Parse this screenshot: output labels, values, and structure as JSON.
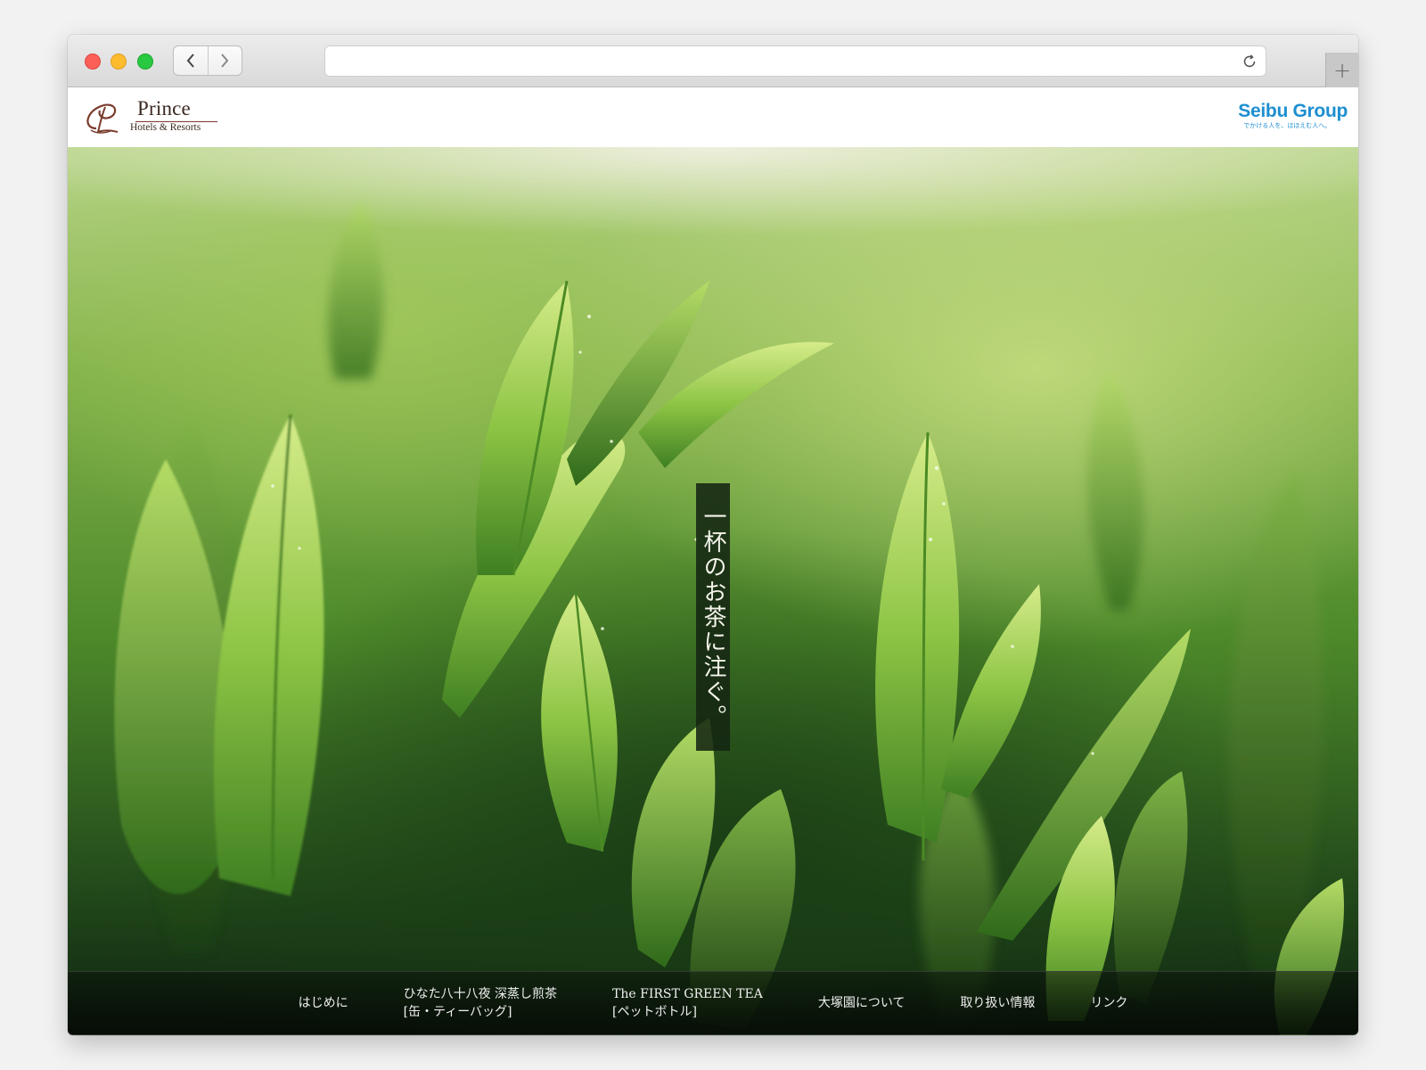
{
  "browser": {
    "url": "",
    "back_icon": "chevron-left-icon",
    "forward_icon": "chevron-right-icon",
    "reload_icon": "reload-icon",
    "new_tab_label": "+"
  },
  "header": {
    "prince_logo": {
      "name": "Prince",
      "subtitle": "Hotels & Resorts",
      "color": "#7a3b2c"
    },
    "seibu_logo": {
      "name": "Seibu Group",
      "tagline": "でかける人を、ほほえむ人へ。",
      "color": "#1d8fd1"
    }
  },
  "hero": {
    "tagline": "一杯のお茶に注ぐ。"
  },
  "nav": {
    "items": [
      {
        "line1": "はじめに",
        "line2": ""
      },
      {
        "line1": "ひなた八十八夜 深蒸し煎茶",
        "line2": "[缶・ティーバッグ]"
      },
      {
        "line1": "The FIRST GREEN TEA",
        "line2": "[ペットボトル]"
      },
      {
        "line1": "大塚園について",
        "line2": ""
      },
      {
        "line1": "取り扱い情報",
        "line2": ""
      },
      {
        "line1": "リンク",
        "line2": ""
      }
    ]
  }
}
